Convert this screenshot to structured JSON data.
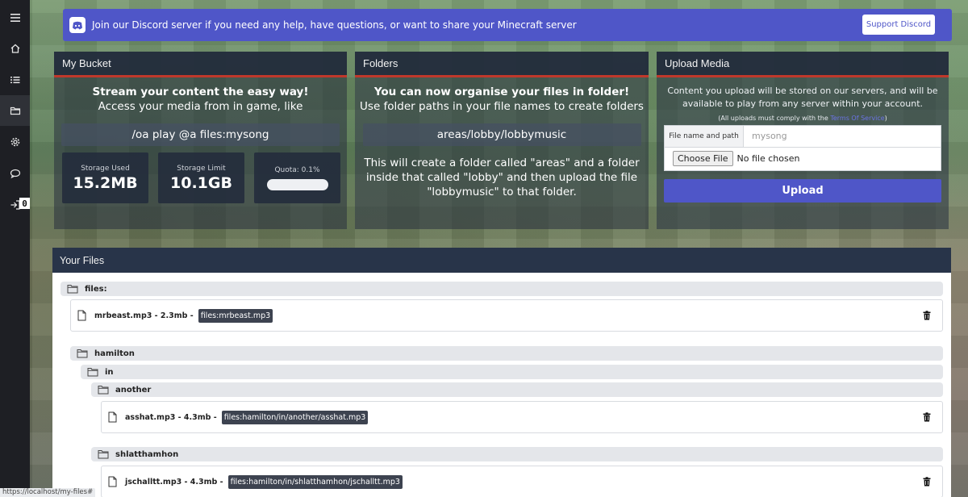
{
  "banner": {
    "text": "Join our Discord server if you need any help, have questions, or want to share your Minecraft server",
    "button": "Support Discord"
  },
  "sidebar": {
    "items": [
      "menu-icon",
      "home-icon",
      "list-icon",
      "folder-icon",
      "gear-icon",
      "chat-icon",
      "logout-icon"
    ],
    "badge": "0"
  },
  "bucket": {
    "title": "My Bucket",
    "headline": "Stream your content the easy way!",
    "subline": "Access your media from in game, like",
    "command": "/oa play @a files:mysong",
    "used_label": "Storage Used",
    "used_value": "15.2MB",
    "limit_label": "Storage Limit",
    "limit_value": "10.1GB",
    "quota_label": "Quota: 0.1%",
    "quota_percent": 0.1
  },
  "folders": {
    "title": "Folders",
    "headline": "You can now organise your files in folder!",
    "subline": "Use folder paths in your file names to create folders",
    "example": "areas/lobby/lobbymusic",
    "description": "This will create a folder called \"areas\" and a folder inside that called \"lobby\" and then upload the file \"lobbymusic\" to that folder."
  },
  "upload": {
    "title": "Upload Media",
    "intro": "Content you upload will be stored on our servers, and will be available to play from any server within your account.",
    "notice_prefix": "(All uploads must comply with the ",
    "notice_link": "Terms Of Service",
    "notice_suffix": ")",
    "name_label": "File name and path",
    "name_placeholder": "mysong",
    "choose_label": "Choose File",
    "no_file": "No file chosen",
    "button": "Upload"
  },
  "files": {
    "title": "Your Files",
    "root": "files:",
    "hamilton": "hamilton",
    "in": "in",
    "another": "another",
    "shlatthamhon": "shlatthamhon",
    "items": [
      {
        "name": "mrbeast.mp3 - 2.3mb -",
        "path": "files:mrbeast.mp3"
      },
      {
        "name": "asshat.mp3 - 4.3mb -",
        "path": "files:hamilton/in/another/asshat.mp3"
      },
      {
        "name": "jschalltt.mp3 - 4.3mb -",
        "path": "files:hamilton/in/shlatthamhon/jschalltt.mp3"
      }
    ]
  },
  "status_url": "https://localhost/my-files#"
}
